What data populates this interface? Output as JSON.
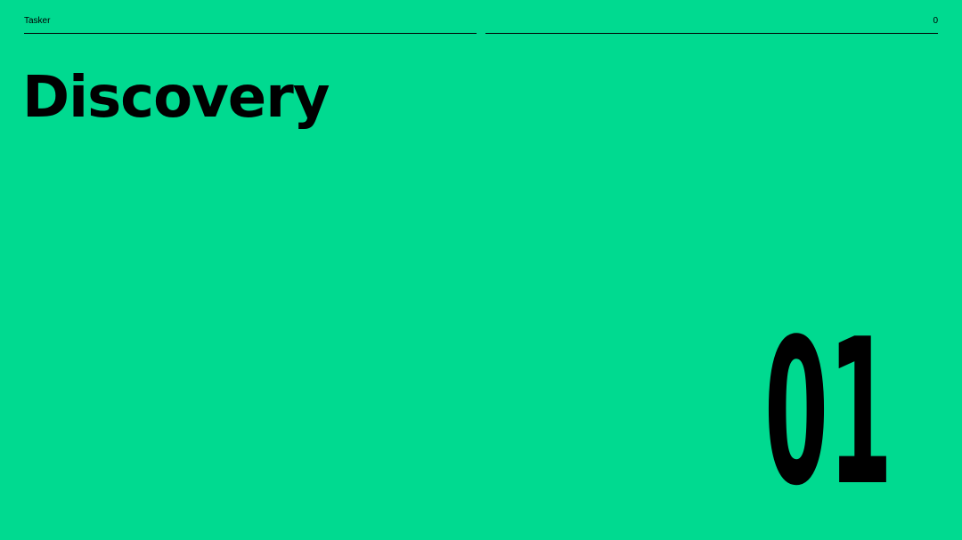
{
  "header": {
    "brand": "Tasker",
    "page_number": "0"
  },
  "slide": {
    "title": "Discovery",
    "section_number": "01"
  },
  "colors": {
    "background": "#00DA90",
    "text": "#000000"
  }
}
